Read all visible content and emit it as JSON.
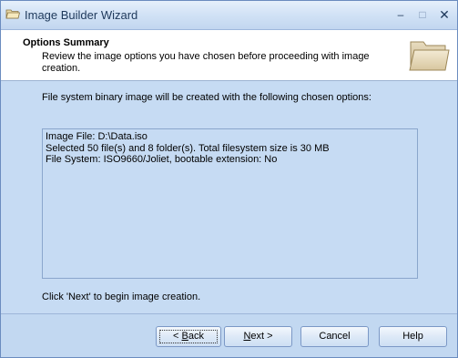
{
  "window": {
    "title": "Image Builder Wizard",
    "icon": "folder-icon",
    "controls": {
      "minimize": "–",
      "maximize": "□",
      "close": "✕"
    }
  },
  "header": {
    "title": "Options Summary",
    "description": "Review the image options you have chosen before proceeding with image creation.",
    "icon": "folder-icon"
  },
  "content": {
    "intro": "File system binary image will be created with the following chosen options:",
    "summary_lines": [
      "Image File: D:\\Data.iso",
      "Selected 50 file(s) and 8 folder(s). Total filesystem size is 30 MB",
      "File System: ISO9660/Joliet, bootable extension: No"
    ],
    "hint": "Click 'Next' to begin image creation."
  },
  "buttons": {
    "back_prefix": "< ",
    "back_accel": "B",
    "back_rest": "ack",
    "next_accel": "N",
    "next_rest": "ext >",
    "cancel": "Cancel",
    "help": "Help"
  },
  "colors": {
    "window_bg": "#c6dbf3",
    "header_bg": "#ffffff",
    "title_text": "#1e395b",
    "border": "#8aa6cc"
  }
}
